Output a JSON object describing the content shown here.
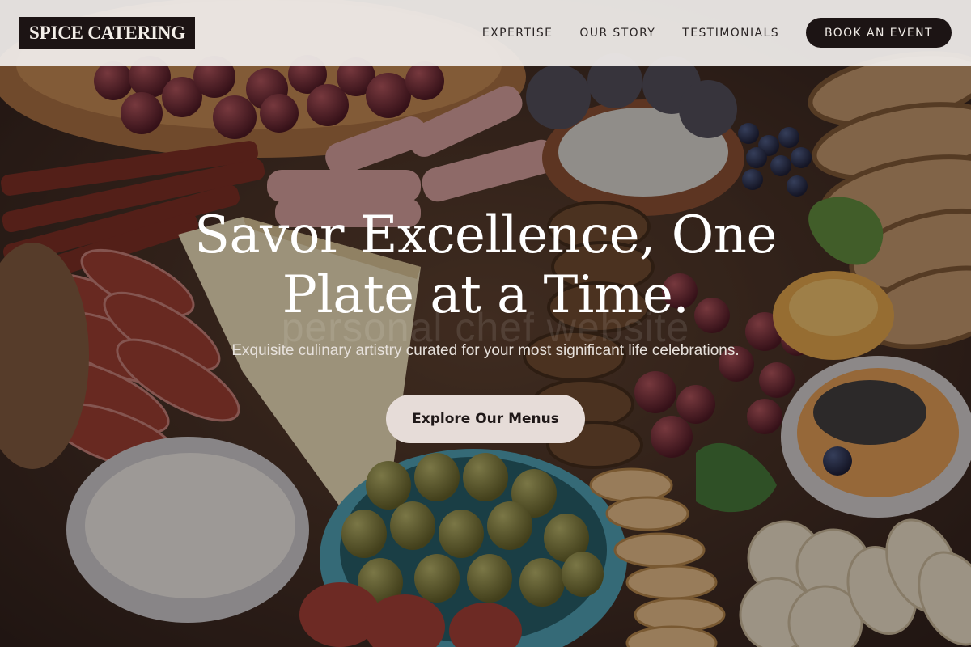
{
  "brand": {
    "logo_text": "SPICE CATERING"
  },
  "nav": {
    "items": [
      {
        "label": "EXPERTISE"
      },
      {
        "label": "OUR STORY"
      },
      {
        "label": "TESTIMONIALS"
      }
    ],
    "cta_label": "BOOK AN EVENT"
  },
  "hero": {
    "headline": "Savor Excellence, One Plate at a Time.",
    "watermark": "personal chef website",
    "subheadline": "Exquisite culinary artistry curated for your most significant life celebrations.",
    "button_label": "Explore Our Menus",
    "image": "charcuterie-board-photo"
  },
  "colors": {
    "header_bg": "#f1eeec",
    "dark": "#1c1414",
    "button_light": "#e6dcd8"
  }
}
